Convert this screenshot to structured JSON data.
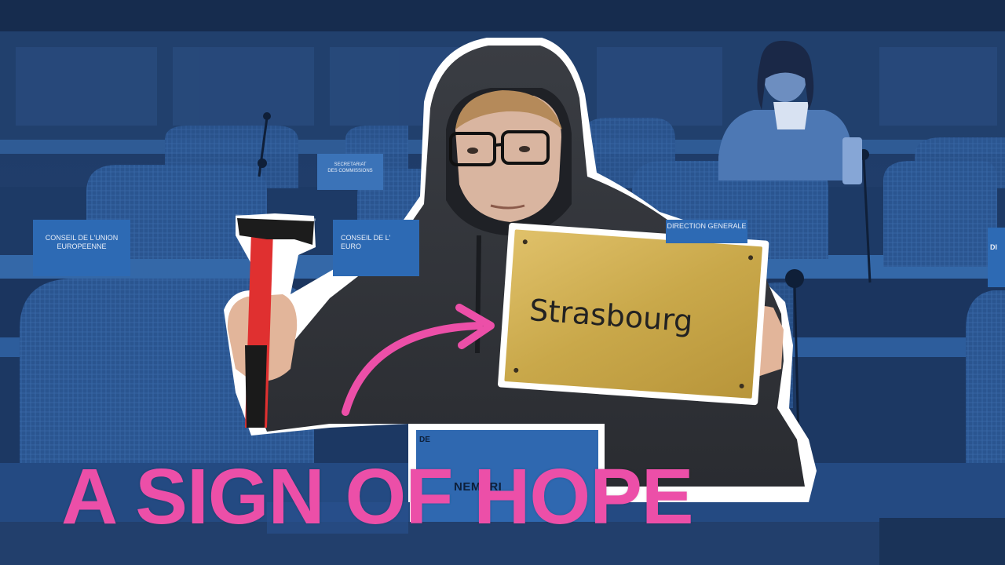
{
  "thumbnail": {
    "headline": "A SIGN OF HOPE",
    "sign_text": "Strasbourg",
    "desk_placard_left": "CONSEIL DE L'UNION\nEUROPEENNE",
    "desk_placard_mid": "CONSEIL DE L'\nEURO",
    "desk_placard_right": "DIRECTION GENERALE",
    "desk_placard_back": "SECRETARIAT\nDES COMMISSIONS",
    "desk_placard_edge": "DI",
    "front_placard_code": "DE",
    "front_placard_name": "NEMSRI"
  },
  "colors": {
    "headline": "#ec4fa8",
    "arrow": "#ec4fa8",
    "background_tint": "#1e3a66",
    "sign_plate": "#c9a84a"
  }
}
